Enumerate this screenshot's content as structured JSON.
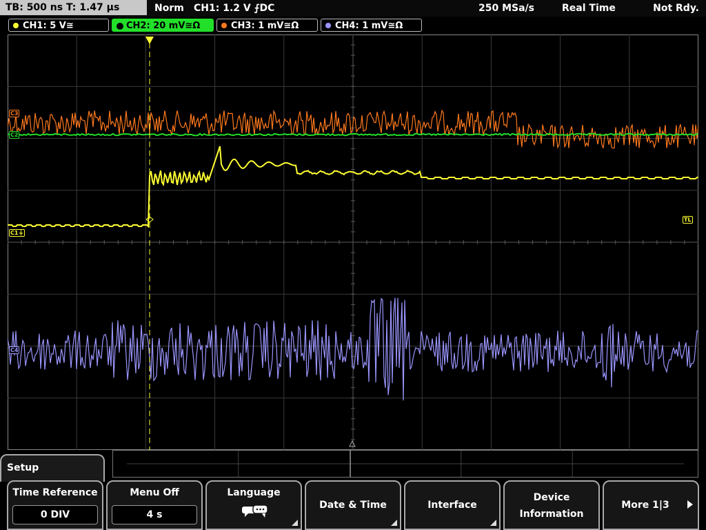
{
  "topbar": {
    "tb_text": "TB: 500 ns   T: 1.47 µs",
    "trigger_mode": "Norm",
    "trigger_info": "CH1: 1.2 V ⨍DC",
    "sample_rate": "250 MSa/s",
    "acq_mode": "Real Time",
    "status": "Not Rdy."
  },
  "channels": [
    {
      "label": "CH1: 5 V≅",
      "color": "#ffff33"
    },
    {
      "label": "CH2: 20 mV≅Ω",
      "color": "#22e02a"
    },
    {
      "label": "CH3: 1 mV≅Ω",
      "color": "#ff7a1e"
    },
    {
      "label": "CH4: 1 mV≅Ω",
      "color": "#9b96ff"
    }
  ],
  "markers": {
    "c3": "C3",
    "c2": "C2",
    "c1": "C1⏚",
    "c4": "C4",
    "tl": "TL"
  },
  "menu": {
    "title": "Setup",
    "keys": [
      {
        "label": "Time Reference",
        "value": "0 DIV"
      },
      {
        "label": "Menu Off",
        "value": "4 s"
      },
      {
        "label": "Language",
        "icon": "speech-bubbles-icon"
      },
      {
        "label": "Date & Time"
      },
      {
        "label": "Interface"
      },
      {
        "label": "Device",
        "label2": "Information"
      },
      {
        "label": "More 1|3"
      }
    ]
  }
}
